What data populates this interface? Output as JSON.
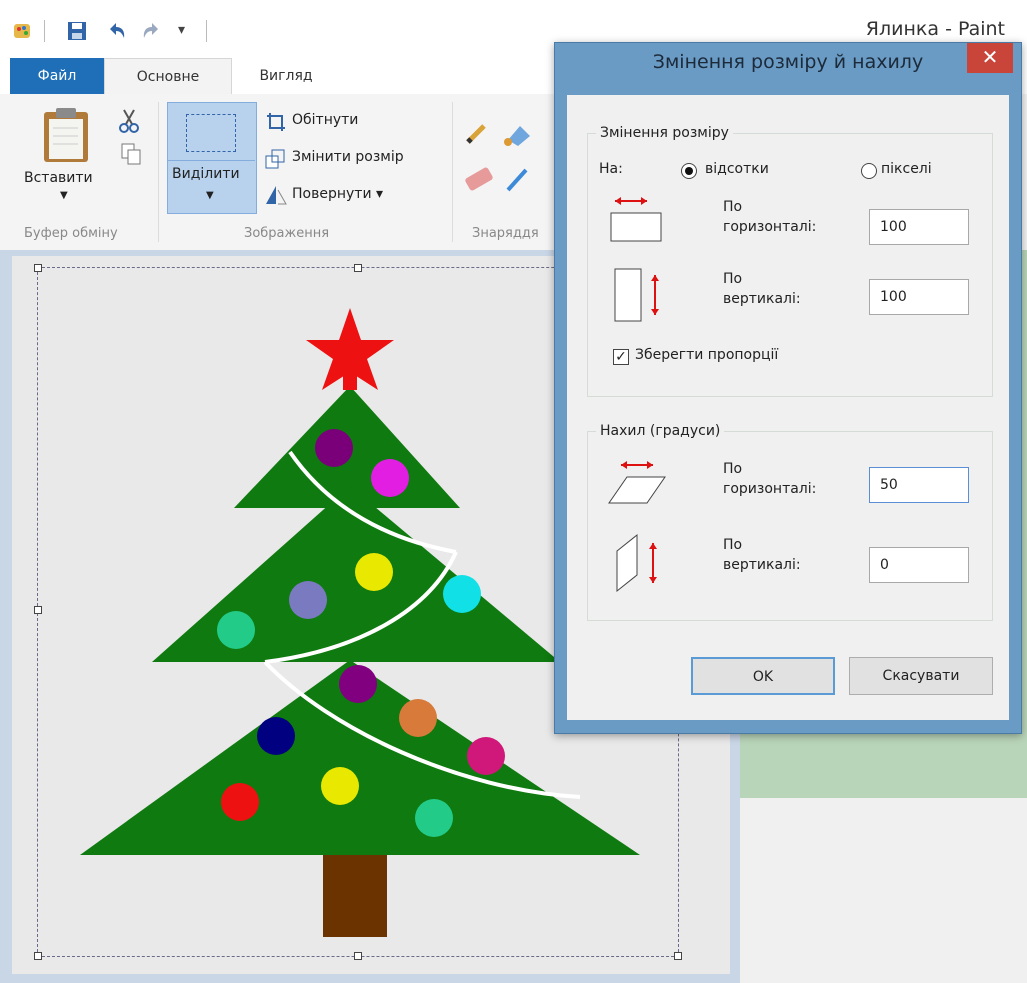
{
  "window": {
    "title": "Ялинка - Paint"
  },
  "ribbon": {
    "tabs": [
      {
        "label": "Файл"
      },
      {
        "label": "Основне"
      },
      {
        "label": "Вигляд"
      }
    ],
    "paste_label": "Вставити",
    "select_label": "Виділити",
    "crop_label": "Обітнути",
    "resize_label": "Змінити розмір",
    "rotate_label": "Повернути ▾",
    "groups": {
      "clipboard": "Буфер обміну",
      "image": "Зображення",
      "tools": "Знаряддя"
    }
  },
  "dialog": {
    "title": "Змінення розміру й нахилу",
    "close": "✕",
    "resize_group": "Змінення розміру",
    "by_label": "На:",
    "percent_label": "відсотки",
    "pixels_label": "пікселі",
    "unit_selected": "percent",
    "resize_h_line1": "По",
    "resize_h_line2": "горизонталі:",
    "resize_h_value": "100",
    "resize_v_line1": "По",
    "resize_v_line2": "вертикалі:",
    "resize_v_value": "100",
    "keep_ratio_label": "Зберегти пропорції",
    "keep_ratio_checked": true,
    "skew_group": "Нахил (градуси)",
    "skew_h_line1": "По",
    "skew_h_line2": "горизонталі:",
    "skew_h_value": "50",
    "skew_v_line1": "По",
    "skew_v_line2": "вертикалі:",
    "skew_v_value": "0",
    "ok_label": "OK",
    "cancel_label": "Скасувати"
  },
  "colors": {
    "tree_green": "#0f7a0f",
    "trunk_brown": "#6b3300",
    "star_red": "#ee1111",
    "garland": "#ffffff"
  },
  "ornaments": [
    {
      "color": "#7a007a"
    },
    {
      "color": "#e31ee3"
    },
    {
      "color": "#e8e800"
    },
    {
      "color": "#7a7ac0"
    },
    {
      "color": "#11e0e6"
    },
    {
      "color": "#22cc88"
    },
    {
      "color": "#800080"
    },
    {
      "color": "#d77a3a"
    },
    {
      "color": "#000080"
    },
    {
      "color": "#d0177a"
    },
    {
      "color": "#e8e800"
    },
    {
      "color": "#ee1111"
    },
    {
      "color": "#22cc88"
    }
  ]
}
